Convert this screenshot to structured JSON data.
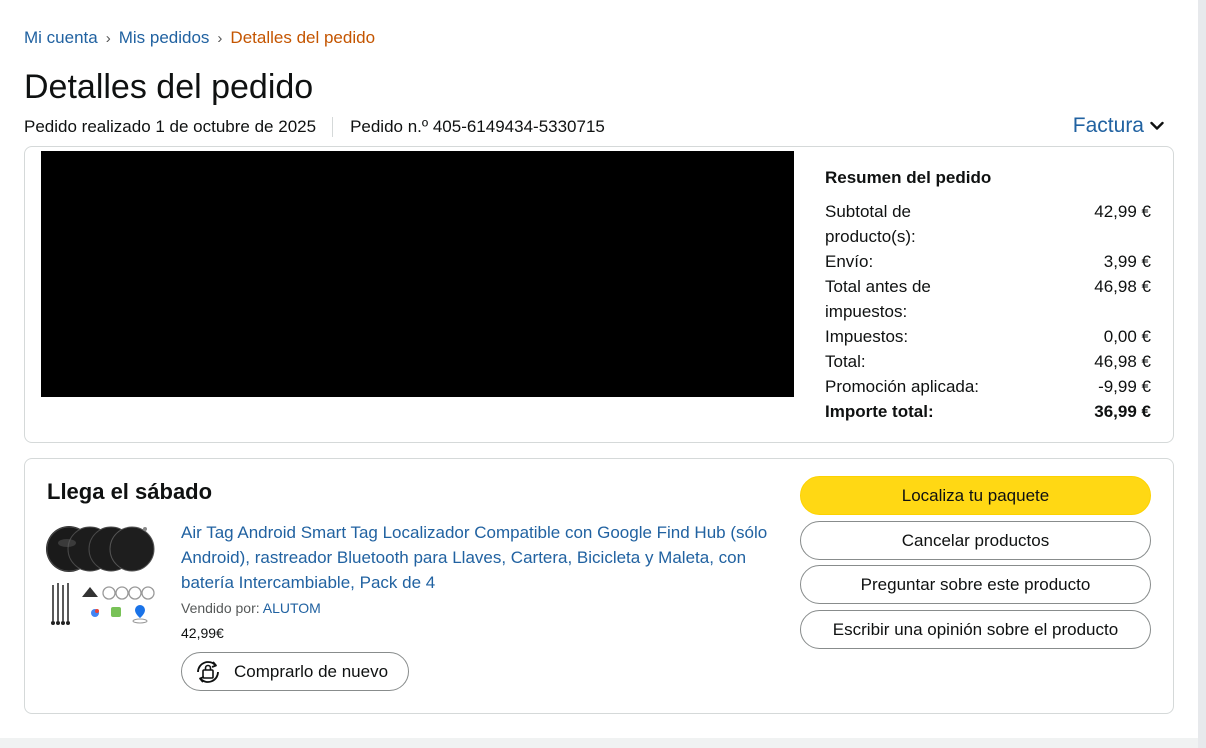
{
  "breadcrumb": {
    "items": [
      "Mi cuenta",
      "Mis pedidos",
      "Detalles del pedido"
    ],
    "separator": "›"
  },
  "page_title": "Detalles del pedido",
  "order": {
    "placed": "Pedido realizado 1 de octubre de 2025",
    "number": "Pedido n.º 405-6149434-5330715",
    "invoice_label": "Factura"
  },
  "summary": {
    "title": "Resumen del pedido",
    "rows": [
      {
        "label": "Subtotal de producto(s):",
        "value": "42,99 €"
      },
      {
        "label": "Envío:",
        "value": "3,99 €"
      },
      {
        "label": "Total antes de impuestos:",
        "value": "46,98 €"
      },
      {
        "label": "Impuestos:",
        "value": "0,00 €"
      },
      {
        "label": "Total:",
        "value": "46,98 €"
      },
      {
        "label": "Promoción aplicada:",
        "value": "-9,99 €"
      },
      {
        "label": "Importe total:",
        "value": "36,99 €"
      }
    ]
  },
  "shipment": {
    "arrival": "Llega el sábado",
    "product": {
      "title": "Air Tag Android Smart Tag Localizador Compatible con Google Find Hub (sólo Android), rastreador Bluetooth para Llaves, Cartera, Bicicleta y Maleta, con batería Intercambiable, Pack de 4",
      "sold_by_label": "Vendido por:",
      "seller": "ALUTOM",
      "price": "42,99€",
      "rebuy_label": "Comprarlo de nuevo"
    },
    "actions": {
      "track": "Localiza tu paquete",
      "cancel": "Cancelar productos",
      "ask": "Preguntar sobre este producto",
      "review": "Escribir una opinión sobre el producto"
    }
  },
  "colors": {
    "link": "#2162a1",
    "breadcrumb_current": "#c45500",
    "primary_button": "#ffd814",
    "redacted": "#000000"
  },
  "icons": [
    "chevron-down-icon",
    "rebuy-icon"
  ]
}
